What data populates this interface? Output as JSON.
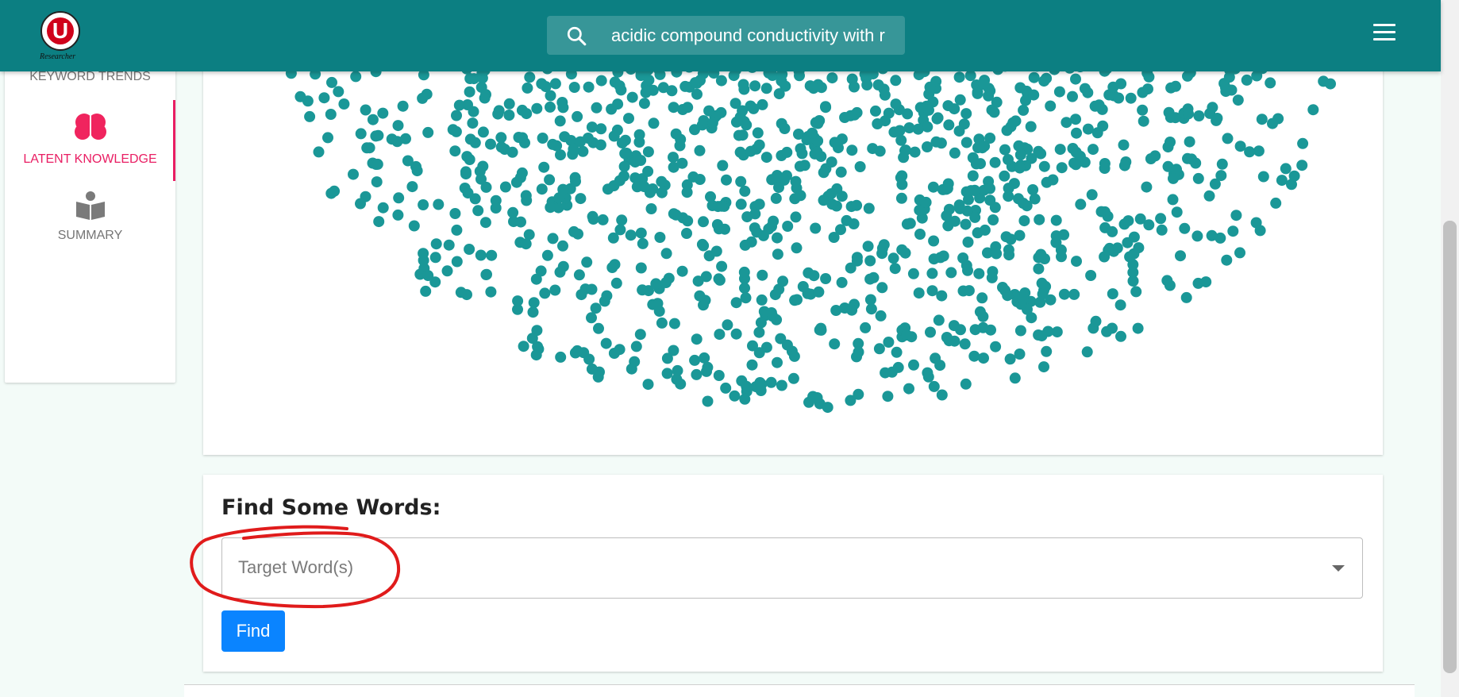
{
  "header": {
    "logo_text": "Researcher",
    "logo_letter": "U",
    "search_value": "acidic compound conductivity with r",
    "brand_color": "#0c7f82"
  },
  "sidebar": {
    "items": [
      {
        "label": "KEYWORD TRENDS",
        "icon": "trend-icon",
        "active": false
      },
      {
        "label": "LATENT KNOWLEDGE",
        "icon": "brain-icon",
        "active": true
      },
      {
        "label": "SUMMARY",
        "icon": "book-icon",
        "active": false
      }
    ],
    "active_color": "#e91e63"
  },
  "chart_data": {
    "type": "scatter",
    "title": "",
    "xlabel": "",
    "ylabel": "",
    "point_color": "#1a9797",
    "grid": false,
    "legend": "none"
  },
  "find": {
    "title": "Find Some Words:",
    "placeholder": "Target Word(s)",
    "button_label": "Find",
    "button_color": "#0a84ff"
  }
}
